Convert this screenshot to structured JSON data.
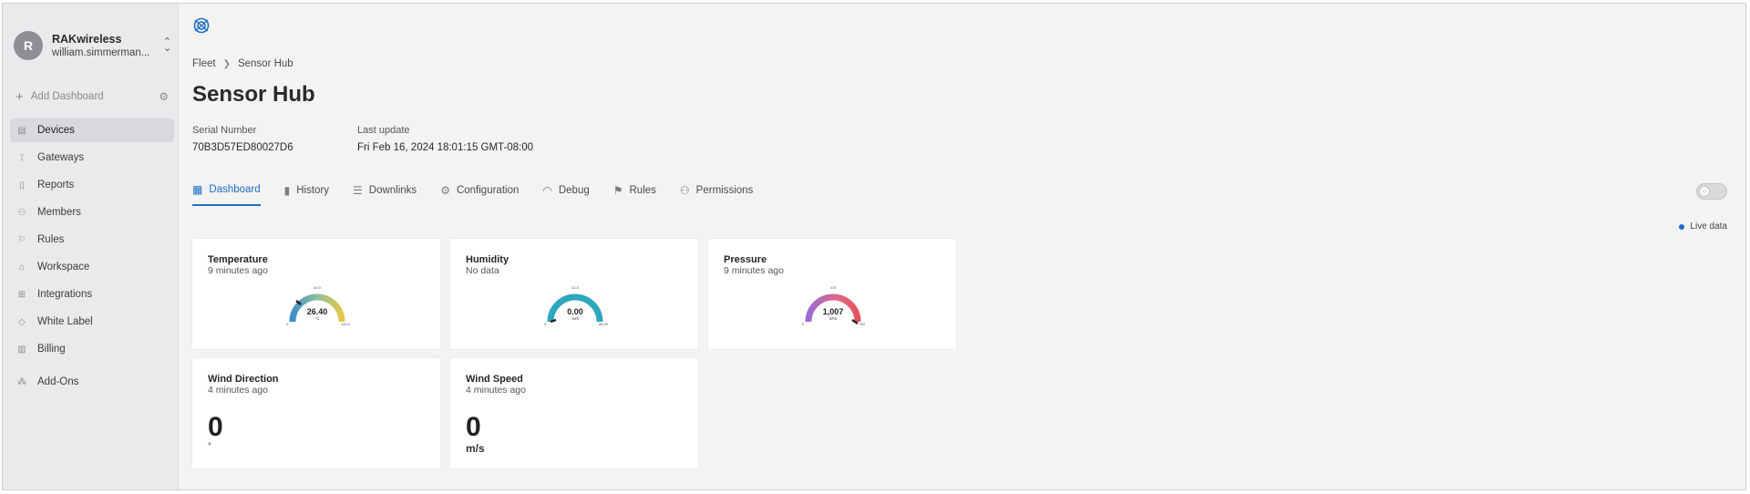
{
  "account": {
    "initial": "R",
    "name": "RAKwireless",
    "email": "william.simmerman..."
  },
  "sidebar": {
    "add_dashboard": "Add Dashboard",
    "items": [
      {
        "label": "Devices",
        "icon": "devices-icon",
        "active": true
      },
      {
        "label": "Gateways",
        "icon": "gateway-icon"
      },
      {
        "label": "Reports",
        "icon": "report-icon"
      },
      {
        "label": "Members",
        "icon": "members-icon"
      },
      {
        "label": "Rules",
        "icon": "rules-icon"
      },
      {
        "label": "Workspace",
        "icon": "workspace-icon"
      },
      {
        "label": "Integrations",
        "icon": "integrations-icon"
      },
      {
        "label": "White Label",
        "icon": "tag-icon"
      },
      {
        "label": "Billing",
        "icon": "billing-icon"
      },
      {
        "label": "Add-Ons",
        "icon": "addons-icon"
      }
    ]
  },
  "breadcrumb": {
    "parent": "Fleet",
    "current": "Sensor Hub"
  },
  "page": {
    "title": "Sensor Hub",
    "serial_label": "Serial Number",
    "serial_value": "70B3D57ED80027D6",
    "update_label": "Last update",
    "update_value": "Fri Feb 16, 2024 18:01:15 GMT-08:00"
  },
  "tabs": [
    {
      "label": "Dashboard",
      "icon": "dashboard-icon",
      "active": true
    },
    {
      "label": "History",
      "icon": "bar-chart-icon"
    },
    {
      "label": "Downlinks",
      "icon": "sliders-icon"
    },
    {
      "label": "Configuration",
      "icon": "gear-icon"
    },
    {
      "label": "Debug",
      "icon": "rss-icon"
    },
    {
      "label": "Rules",
      "icon": "rules-icon"
    },
    {
      "label": "Permissions",
      "icon": "people-icon"
    }
  ],
  "live_data": "Live data",
  "widgets": {
    "temperature": {
      "title": "Temperature",
      "sub": "9 minutes ago",
      "value": "26.40",
      "unit": "°C",
      "min": "0",
      "max": "100.0",
      "top": "50.0"
    },
    "humidity": {
      "title": "Humidity",
      "sub": "No data",
      "value": "0.00",
      "unit": "%rh",
      "min": "0",
      "max": "85.00",
      "top": "42.5"
    },
    "pressure": {
      "title": "Pressure",
      "sub": "9 minutes ago",
      "value": "1,007",
      "unit": "kPa",
      "min": "0",
      "max": "780",
      "top": "475"
    },
    "wind_direction": {
      "title": "Wind Direction",
      "sub": "4 minutes ago",
      "value": "0",
      "unit": "°"
    },
    "wind_speed": {
      "title": "Wind Speed",
      "sub": "4 minutes ago",
      "value": "0",
      "unit": "m/s"
    }
  },
  "colors": {
    "accent": "#1e6ec9",
    "temp_gauge": [
      "#3e8fc9",
      "#8fbf9d",
      "#e3c84a"
    ],
    "humidity_gauge": [
      "#2a9ec4",
      "#3bb3ad"
    ],
    "pressure_gauge": [
      "#9a6bd0",
      "#e26a8a",
      "#e0535d"
    ]
  }
}
